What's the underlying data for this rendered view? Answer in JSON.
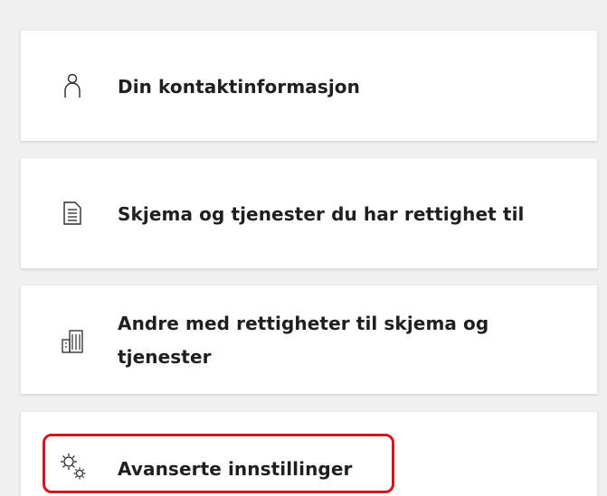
{
  "menu": {
    "items": [
      {
        "label": "Din kontaktinformasjon",
        "icon": "person-icon"
      },
      {
        "label": "Skjema og tjenester du har rettighet til",
        "icon": "document-list-icon"
      },
      {
        "label": "Andre med rettigheter til skjema og tjenester",
        "icon": "building-icon"
      },
      {
        "label": "Avanserte innstillinger",
        "icon": "gears-icon",
        "highlighted": true
      }
    ]
  },
  "colors": {
    "background": "#f0f0f0",
    "card": "#ffffff",
    "text": "#1f1f1f",
    "highlight_border": "#d0181f"
  }
}
